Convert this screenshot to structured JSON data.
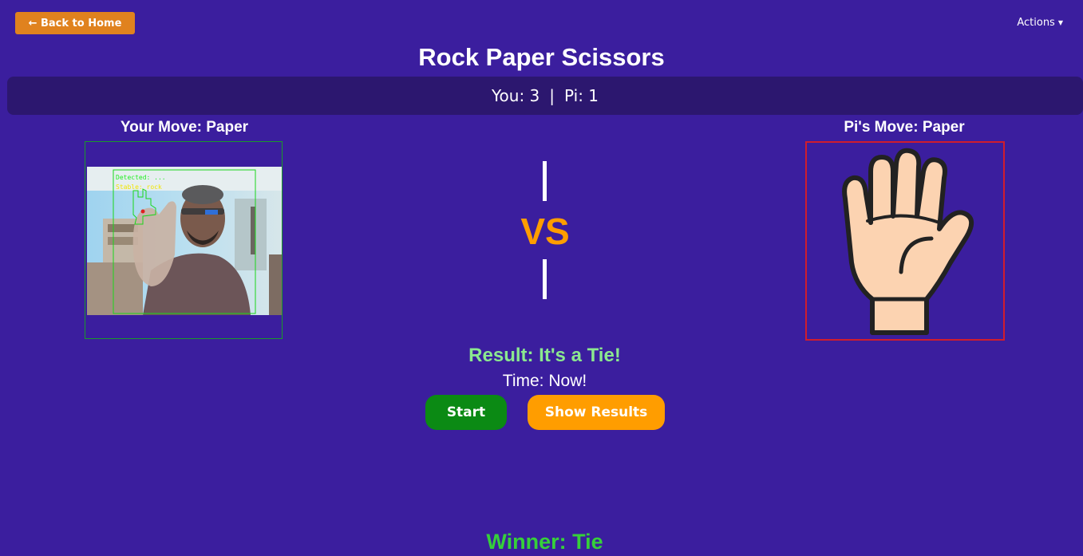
{
  "nav": {
    "back_label": "← Back to Home",
    "actions_label": "Actions"
  },
  "page": {
    "title": "Rock Paper Scissors"
  },
  "score": {
    "you_label": "You: 3",
    "separator": "|",
    "pi_label": "Pi: 1"
  },
  "your_move": {
    "label": "Your Move: Paper",
    "overlay_detected": "Detected: ...",
    "overlay_stable": "Stable: rock"
  },
  "pi_move": {
    "label": "Pi's Move: Paper"
  },
  "vs": {
    "text": "VS"
  },
  "status": {
    "result": "Result: It's a Tie!",
    "time": "Time: Now!",
    "winner": "Winner: Tie"
  },
  "controls": {
    "start_label": "Start",
    "show_results_label": "Show Results"
  },
  "colors": {
    "background": "#3b1e9e",
    "score_bar": "#2c176f",
    "accent_orange": "#ff9d00",
    "start_green": "#0b8a14",
    "result_green": "#8be88f",
    "winner_green": "#36d03a",
    "your_frame": "#1a9a2a",
    "pi_frame": "#d01d2d"
  }
}
